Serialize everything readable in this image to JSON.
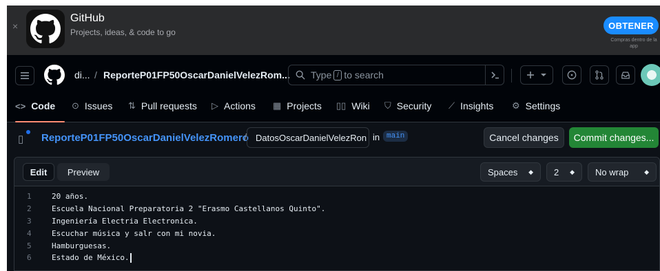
{
  "banner": {
    "close": "×",
    "app_name": "GitHub",
    "tagline": "Projects, ideas, & code to go",
    "get_button": "OBTENER",
    "note": "Compras dentro de la app"
  },
  "header": {
    "owner_crumb": "di...",
    "separator": "/",
    "repo_crumb": "ReporteP01FP50OscarDanielVelezRom...",
    "search": {
      "prefix": "Type",
      "key": "/",
      "suffix": "to search"
    }
  },
  "tabs": [
    {
      "label": "Code",
      "icon": "code-icon",
      "active": true
    },
    {
      "label": "Issues",
      "icon": "issue-icon"
    },
    {
      "label": "Pull requests",
      "icon": "pull-request-icon"
    },
    {
      "label": "Actions",
      "icon": "play-icon"
    },
    {
      "label": "Projects",
      "icon": "table-icon"
    },
    {
      "label": "Wiki",
      "icon": "book-icon"
    },
    {
      "label": "Security",
      "icon": "shield-icon"
    },
    {
      "label": "Insights",
      "icon": "graph-icon"
    },
    {
      "label": "Settings",
      "icon": "gear-icon"
    }
  ],
  "editbar": {
    "repo_link": "ReporteP01FP50OscarDanielVelezRomero",
    "path_sep": "/",
    "filename": "DatosOscarDanielVelezRon",
    "in_label": "in",
    "branch": "main",
    "cancel": "Cancel changes",
    "commit": "Commit changes..."
  },
  "editor": {
    "tab_edit": "Edit",
    "tab_preview": "Preview",
    "indent_mode": "Spaces",
    "indent_size": "2",
    "wrap_mode": "No wrap",
    "lines": [
      {
        "n": "1",
        "text": "20 años."
      },
      {
        "n": "2",
        "text": "Escuela Nacional Preparatoria 2 \"Erasmo Castellanos Quinto\"."
      },
      {
        "n": "3",
        "text": "Ingeniería Electria Electronica."
      },
      {
        "n": "4",
        "text": "Escuchar música y salr con mi novia."
      },
      {
        "n": "5",
        "text": "Hamburguesas."
      },
      {
        "n": "6",
        "text": "Estado de México."
      }
    ]
  },
  "colors": {
    "background": "#0d1117",
    "accent_link": "#4493f8",
    "commit_green": "#238636",
    "active_tab_underline": "#fd8c73",
    "banner_button": "#1a8cff"
  }
}
